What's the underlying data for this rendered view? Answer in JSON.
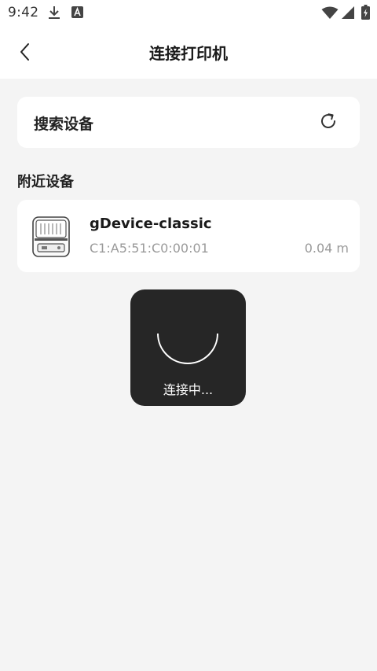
{
  "status_bar": {
    "time": "9:42",
    "icons": [
      "download-icon",
      "text-a-icon",
      "wifi-icon",
      "signal-icon",
      "battery-charging-icon"
    ]
  },
  "header": {
    "title": "连接打印机",
    "back_icon": "chevron-left-icon"
  },
  "search": {
    "label": "搜索设备",
    "refresh_icon": "refresh-icon"
  },
  "nearby": {
    "section_title": "附近设备",
    "devices": [
      {
        "name": "gDevice-classic",
        "mac": "C1:A5:51:C0:00:01",
        "distance": "0.04 m",
        "icon": "printer-icon"
      }
    ]
  },
  "loading": {
    "text": "连接中..."
  },
  "colors": {
    "background": "#f4f4f4",
    "card": "#ffffff",
    "toast": "#262626",
    "muted_text": "#9a9a9a"
  }
}
